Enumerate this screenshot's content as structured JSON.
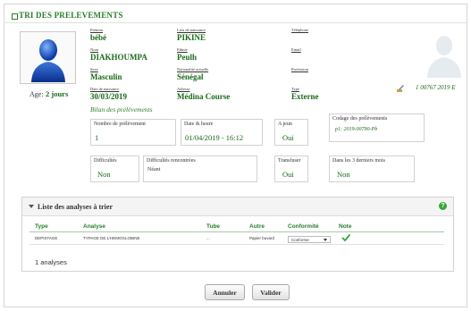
{
  "page_title": "TRI DES PRELEVEMENTS",
  "patient": {
    "fields": [
      {
        "label": "Prénom",
        "value": "bébé"
      },
      {
        "label": "Lieu de naissance",
        "value": "PIKINE"
      },
      {
        "label": "Téléphone",
        "value": ""
      },
      {
        "label": "Nom",
        "value": "DIAKHOUMPA"
      },
      {
        "label": "Ethnie",
        "value": "Peulh"
      },
      {
        "label": "Email",
        "value": ""
      },
      {
        "label": "Sexe",
        "value": "Masculin"
      },
      {
        "label": "Nationalité actuelle",
        "value": "Sénégal"
      },
      {
        "label": "Profession",
        "value": ""
      },
      {
        "label": "Date de naissance",
        "value": "30/03/2019"
      },
      {
        "label": "Adresse",
        "value": "Médina Course"
      },
      {
        "label": "Type",
        "value": "Externe"
      }
    ],
    "age_label": "Age:",
    "age_value": "2 jours",
    "identifier": "1 00767 2019 E"
  },
  "bilan_title": "Bilan des prélèvements",
  "bilan": {
    "nb_label": "Nombre de prélèvement",
    "nb_value": "1",
    "date_label": "Date & heure",
    "date_value": "01/04/2019 - 16:12",
    "jeun_label": "A jeun",
    "jeun_value": "Oui",
    "code_label": "Codage des prélèvements",
    "code_value": "p1:   2019-00790-Pb",
    "diff_label": "Difficultés",
    "diff_value": "Non",
    "diffr_label": "Difficultés rencontrées",
    "diffr_value": "Néant",
    "transf_label": "Transfuser",
    "transf_value": "Oui",
    "mois_label": "Dans les 3 derniers mois",
    "mois_value": "Non"
  },
  "analyses": {
    "title": "Liste des analyses à trier",
    "columns": [
      "Type",
      "Analyse",
      "Tube",
      "Autre",
      "Conformité",
      "Note"
    ],
    "rows": [
      {
        "type": "DEPISTAGE",
        "analyse": "TYPAGE DE L'HEMOGLOBINE",
        "tube": "...",
        "autre": "Papier buvard",
        "conformite": "Conforme"
      }
    ],
    "count_text": "1 analyses"
  },
  "buttons": {
    "cancel": "Annuler",
    "validate": "Valider"
  },
  "colors": {
    "accent_green": "#2a7d2a",
    "value_green": "#1a6a1a"
  }
}
